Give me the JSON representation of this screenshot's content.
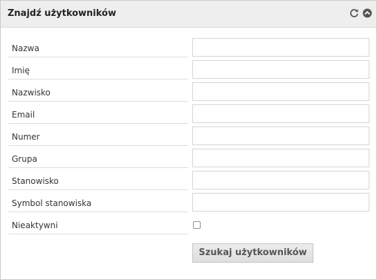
{
  "panel": {
    "title": "Znajdź użytkowników",
    "header_icons": [
      "refresh-icon",
      "collapse-icon"
    ]
  },
  "form": {
    "fields": [
      {
        "label": "Nazwa",
        "value": ""
      },
      {
        "label": "Imię",
        "value": ""
      },
      {
        "label": "Nazwisko",
        "value": ""
      },
      {
        "label": "Email",
        "value": ""
      },
      {
        "label": "Numer",
        "value": ""
      },
      {
        "label": "Grupa",
        "value": ""
      },
      {
        "label": "Stanowisko",
        "value": ""
      },
      {
        "label": "Symbol stanowiska",
        "value": ""
      }
    ],
    "inactive": {
      "label": "Nieaktywni",
      "checked": false
    },
    "submit_label": "Szukaj użytkowników"
  },
  "colors": {
    "header_bg": "#eeeeee",
    "border": "#c8c8c8",
    "icon": "#555555"
  }
}
